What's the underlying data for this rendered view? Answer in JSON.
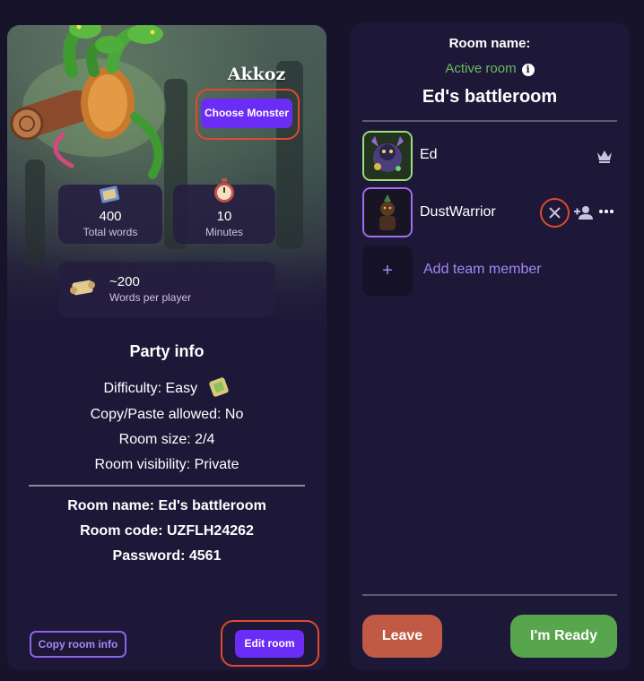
{
  "monster": {
    "name": "Akkoz",
    "choose_label": "Choose Monster"
  },
  "stats": {
    "total_words_value": "400",
    "total_words_label": "Total words",
    "minutes_value": "10",
    "minutes_label": "Minutes",
    "words_per_player_value": "~200",
    "words_per_player_label": "Words per player"
  },
  "party": {
    "title": "Party info",
    "difficulty": "Difficulty: Easy",
    "copy_paste": "Copy/Paste allowed: No",
    "room_size": "Room size: 2/4",
    "room_visibility": "Room visibility: Private",
    "room_name": "Room name: Ed's battleroom",
    "room_code": "Room code: UZFLH24262",
    "password": "Password: 4561"
  },
  "left_actions": {
    "copy_label": "Copy room info",
    "edit_label": "Edit room"
  },
  "room": {
    "name_label": "Room name:",
    "status": "Active room",
    "title": "Ed's battleroom"
  },
  "members": [
    {
      "name": "Ed",
      "role_icon": "crown-icon",
      "border_color": "#9be07a"
    },
    {
      "name": "DustWarrior",
      "actions": [
        "remove-icon",
        "add-friend-icon",
        "more-icon"
      ],
      "border_color": "#a06ef0"
    }
  ],
  "add_member": {
    "label": "Add team member",
    "icon": "+"
  },
  "actions": {
    "leave_label": "Leave",
    "ready_label": "I'm Ready"
  },
  "colors": {
    "accent_purple": "#6b2cf5",
    "active_green": "#6abb5e",
    "leave": "#c05a44",
    "ready": "#57a54d",
    "highlight": "#e2492e",
    "link_purple": "#a488f2"
  }
}
